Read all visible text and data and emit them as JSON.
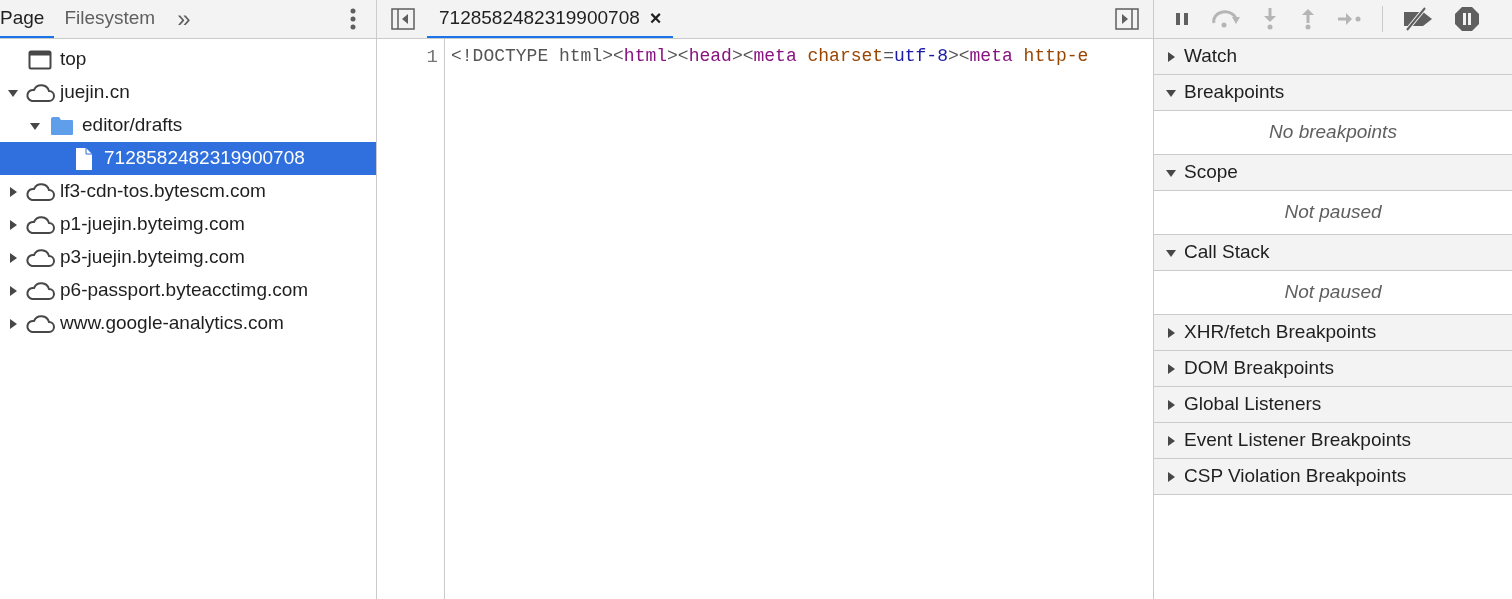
{
  "navigator": {
    "tabs": [
      {
        "label": "Page",
        "selected": true
      },
      {
        "label": "Filesystem",
        "selected": false
      }
    ],
    "more": "»",
    "tree": [
      {
        "kind": "frame",
        "label": "top",
        "selected": false
      },
      {
        "kind": "domain",
        "label": "juejin.cn",
        "expanded": true,
        "selected": false,
        "children": [
          {
            "kind": "folder",
            "label": "editor/drafts",
            "expanded": true,
            "selected": false,
            "children": [
              {
                "kind": "file",
                "label": "7128582482319900708",
                "selected": true
              }
            ]
          }
        ]
      },
      {
        "kind": "domain",
        "label": "lf3-cdn-tos.bytescm.com",
        "expanded": false,
        "selected": false
      },
      {
        "kind": "domain",
        "label": "p1-juejin.byteimg.com",
        "expanded": false,
        "selected": false
      },
      {
        "kind": "domain",
        "label": "p3-juejin.byteimg.com",
        "expanded": false,
        "selected": false
      },
      {
        "kind": "domain",
        "label": "p6-passport.byteacctimg.com",
        "expanded": false,
        "selected": false
      },
      {
        "kind": "domain",
        "label": "www.google-analytics.com",
        "expanded": false,
        "selected": false
      }
    ]
  },
  "editor": {
    "tabs": [
      {
        "label": "7128582482319900708",
        "close": "×",
        "selected": true
      }
    ],
    "lines": [
      {
        "number": "1",
        "tokens": [
          {
            "kind": "plain",
            "text": "<!DOCTYPE html><"
          },
          {
            "kind": "tag",
            "text": "html"
          },
          {
            "kind": "plain",
            "text": "><"
          },
          {
            "kind": "tag",
            "text": "head"
          },
          {
            "kind": "plain",
            "text": "><"
          },
          {
            "kind": "tag",
            "text": "meta"
          },
          {
            "kind": "attr",
            "text": " charset"
          },
          {
            "kind": "plain",
            "text": "="
          },
          {
            "kind": "value",
            "text": "utf-8"
          },
          {
            "kind": "plain",
            "text": "><"
          },
          {
            "kind": "tag",
            "text": "meta"
          },
          {
            "kind": "attr",
            "text": " http-e"
          }
        ]
      }
    ]
  },
  "debugger": {
    "toolbar": [
      {
        "kind": "pause",
        "disabled": false
      },
      {
        "kind": "step-over",
        "disabled": true
      },
      {
        "kind": "step-into",
        "disabled": true
      },
      {
        "kind": "step-out",
        "disabled": true
      },
      {
        "kind": "step",
        "disabled": true
      },
      {
        "kind": "deactivate",
        "disabled": false
      },
      {
        "kind": "pause-exceptions",
        "disabled": false
      }
    ],
    "sections": [
      {
        "title": "Watch",
        "expanded": false
      },
      {
        "title": "Breakpoints",
        "expanded": true,
        "body": "No breakpoints"
      },
      {
        "title": "Scope",
        "expanded": true,
        "body": "Not paused"
      },
      {
        "title": "Call Stack",
        "expanded": true,
        "body": "Not paused"
      },
      {
        "title": "XHR/fetch Breakpoints",
        "expanded": false
      },
      {
        "title": "DOM Breakpoints",
        "expanded": false
      },
      {
        "title": "Global Listeners",
        "expanded": false
      },
      {
        "title": "Event Listener Breakpoints",
        "expanded": false
      },
      {
        "title": "CSP Violation Breakpoints",
        "expanded": false
      }
    ]
  }
}
